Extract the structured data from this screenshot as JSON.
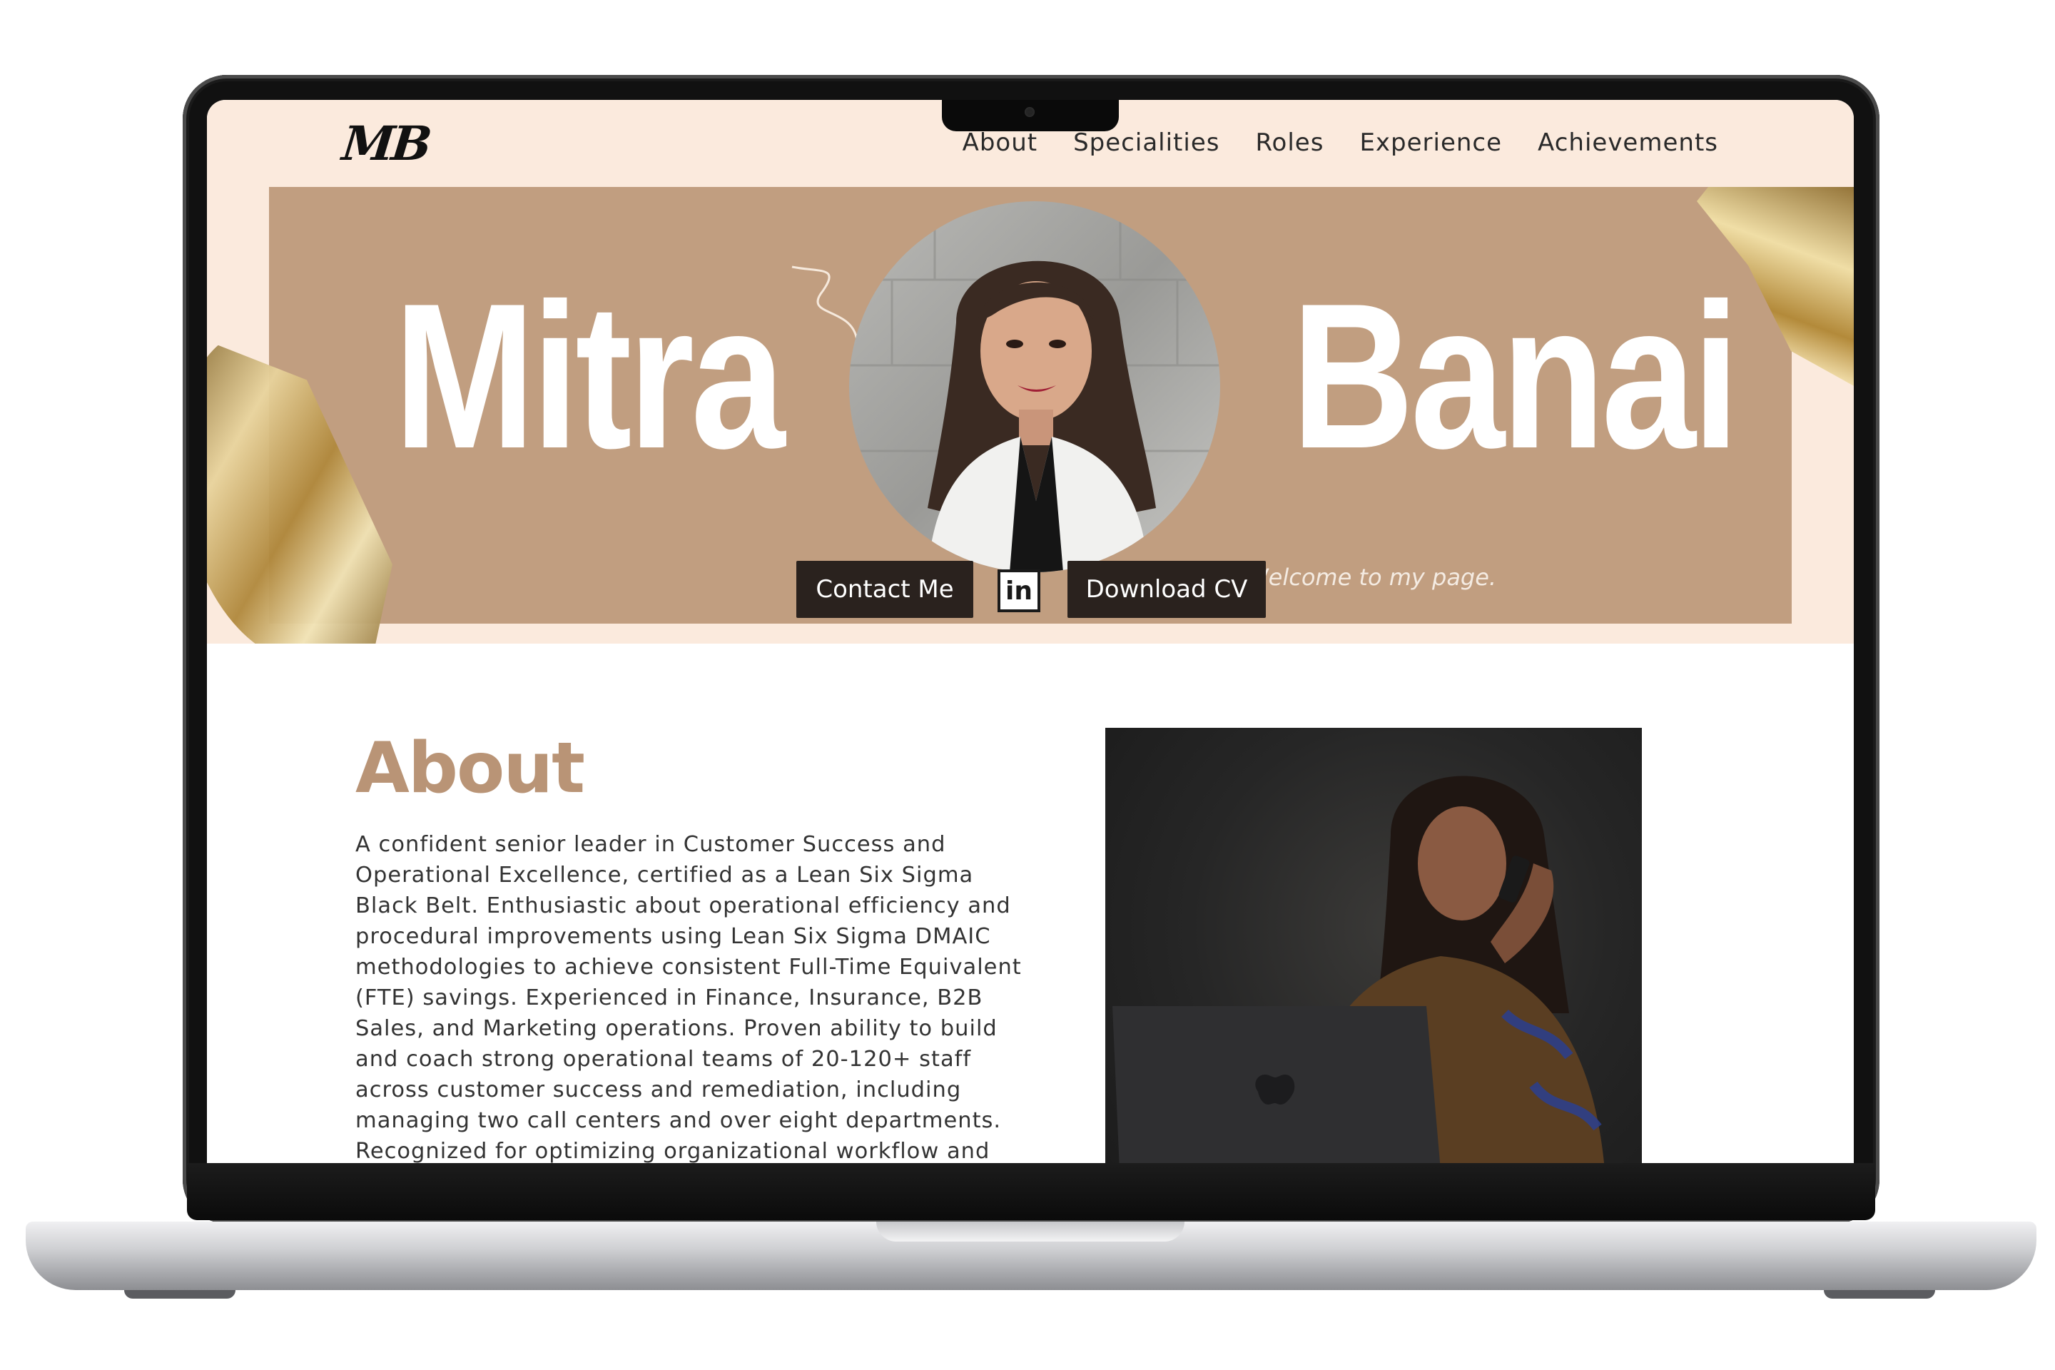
{
  "header": {
    "logo": "MB",
    "nav": [
      "About",
      "Specialities",
      "Roles",
      "Experience",
      "Achievements"
    ]
  },
  "hero": {
    "first_name": "Mitra",
    "last_name": "Banai",
    "welcome": "Welcome to my page.",
    "contact_button": "Contact Me",
    "linkedin_label": "in",
    "download_button": "Download CV"
  },
  "about": {
    "title": "About",
    "body": "A confident senior leader in Customer Success and Operational Excellence, certified as a Lean Six Sigma Black Belt. Enthusiastic about operational efficiency and procedural improvements using Lean Six Sigma DMAIC methodologies to achieve consistent Full-Time Equivalent (FTE) savings. Experienced in Finance, Insurance, B2B Sales, and Marketing operations. Proven ability to build and coach strong operational teams of 20-120+ staff across customer success and remediation, including managing two call centers and over eight departments. Recognized for optimizing organizational workflow and"
  },
  "colors": {
    "hero_band": "#c19e80",
    "page_cream": "#fbeadd",
    "button_dark": "#2a221e",
    "about_title": "#b99476"
  }
}
